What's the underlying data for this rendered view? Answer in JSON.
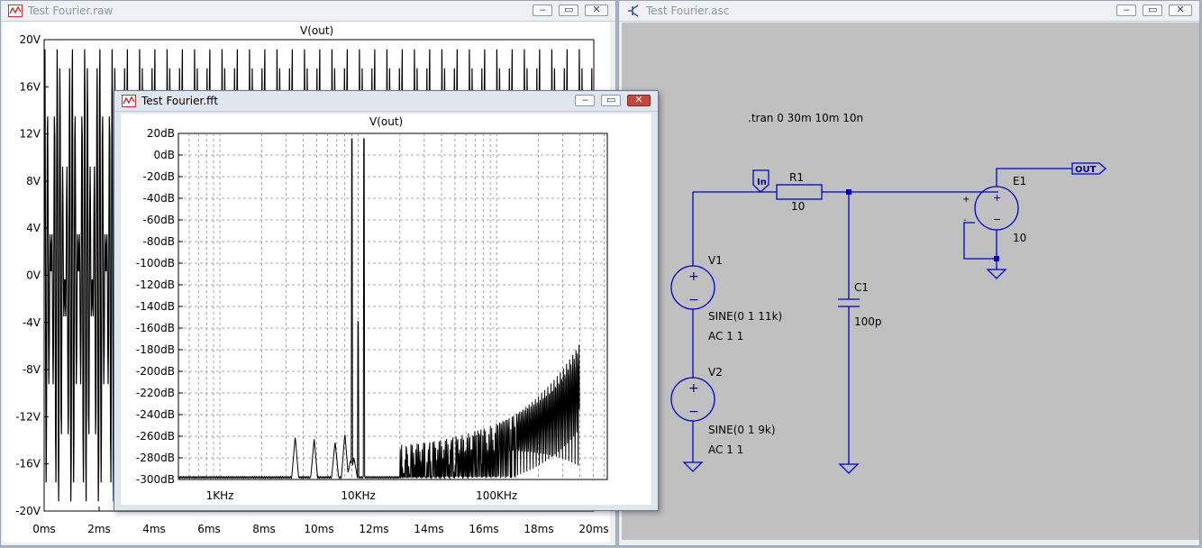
{
  "raw_window": {
    "title": "Test Fourier.raw",
    "plot_title": "V(out)",
    "y_ticks": [
      "20V",
      "16V",
      "12V",
      "8V",
      "4V",
      "0V",
      "-4V",
      "-8V",
      "-12V",
      "-16V",
      "-20V"
    ],
    "x_ticks": [
      "0ms",
      "2ms",
      "4ms",
      "6ms",
      "8ms",
      "10ms",
      "12ms",
      "14ms",
      "16ms",
      "18ms",
      "20ms"
    ]
  },
  "fft_window": {
    "title": "Test Fourier.fft",
    "plot_title": "V(out)",
    "y_ticks": [
      "20dB",
      "0dB",
      "-20dB",
      "-40dB",
      "-60dB",
      "-80dB",
      "-100dB",
      "-120dB",
      "-140dB",
      "-160dB",
      "-180dB",
      "-200dB",
      "-220dB",
      "-240dB",
      "-260dB",
      "-280dB",
      "-300dB"
    ],
    "x_ticks": [
      "1KHz",
      "10KHz",
      "100KHz"
    ]
  },
  "schematic_window": {
    "title": "Test Fourier.asc",
    "directive": ".tran 0 30m 10m 10n",
    "in_label": "In",
    "out_label": "OUT",
    "r1": {
      "name": "R1",
      "value": "10"
    },
    "c1": {
      "name": "C1",
      "value": "100p"
    },
    "v1": {
      "name": "V1",
      "value": "SINE(0 1 11k)",
      "ac": "AC 1 1"
    },
    "v2": {
      "name": "V2",
      "value": "SINE(0 1 9k)",
      "ac": "AC 1 1"
    },
    "e1": {
      "name": "E1",
      "value": "10",
      "plus": "+",
      "minus": "-"
    }
  },
  "colors": {
    "wire": "#0000c8",
    "schematic_bg": "#c0c0c0",
    "trace": "#000000"
  },
  "icons": {
    "raw_window_icon": "waveform-icon",
    "fft_window_icon": "waveform-icon",
    "schematic_window_icon": "transistor-icon"
  }
}
